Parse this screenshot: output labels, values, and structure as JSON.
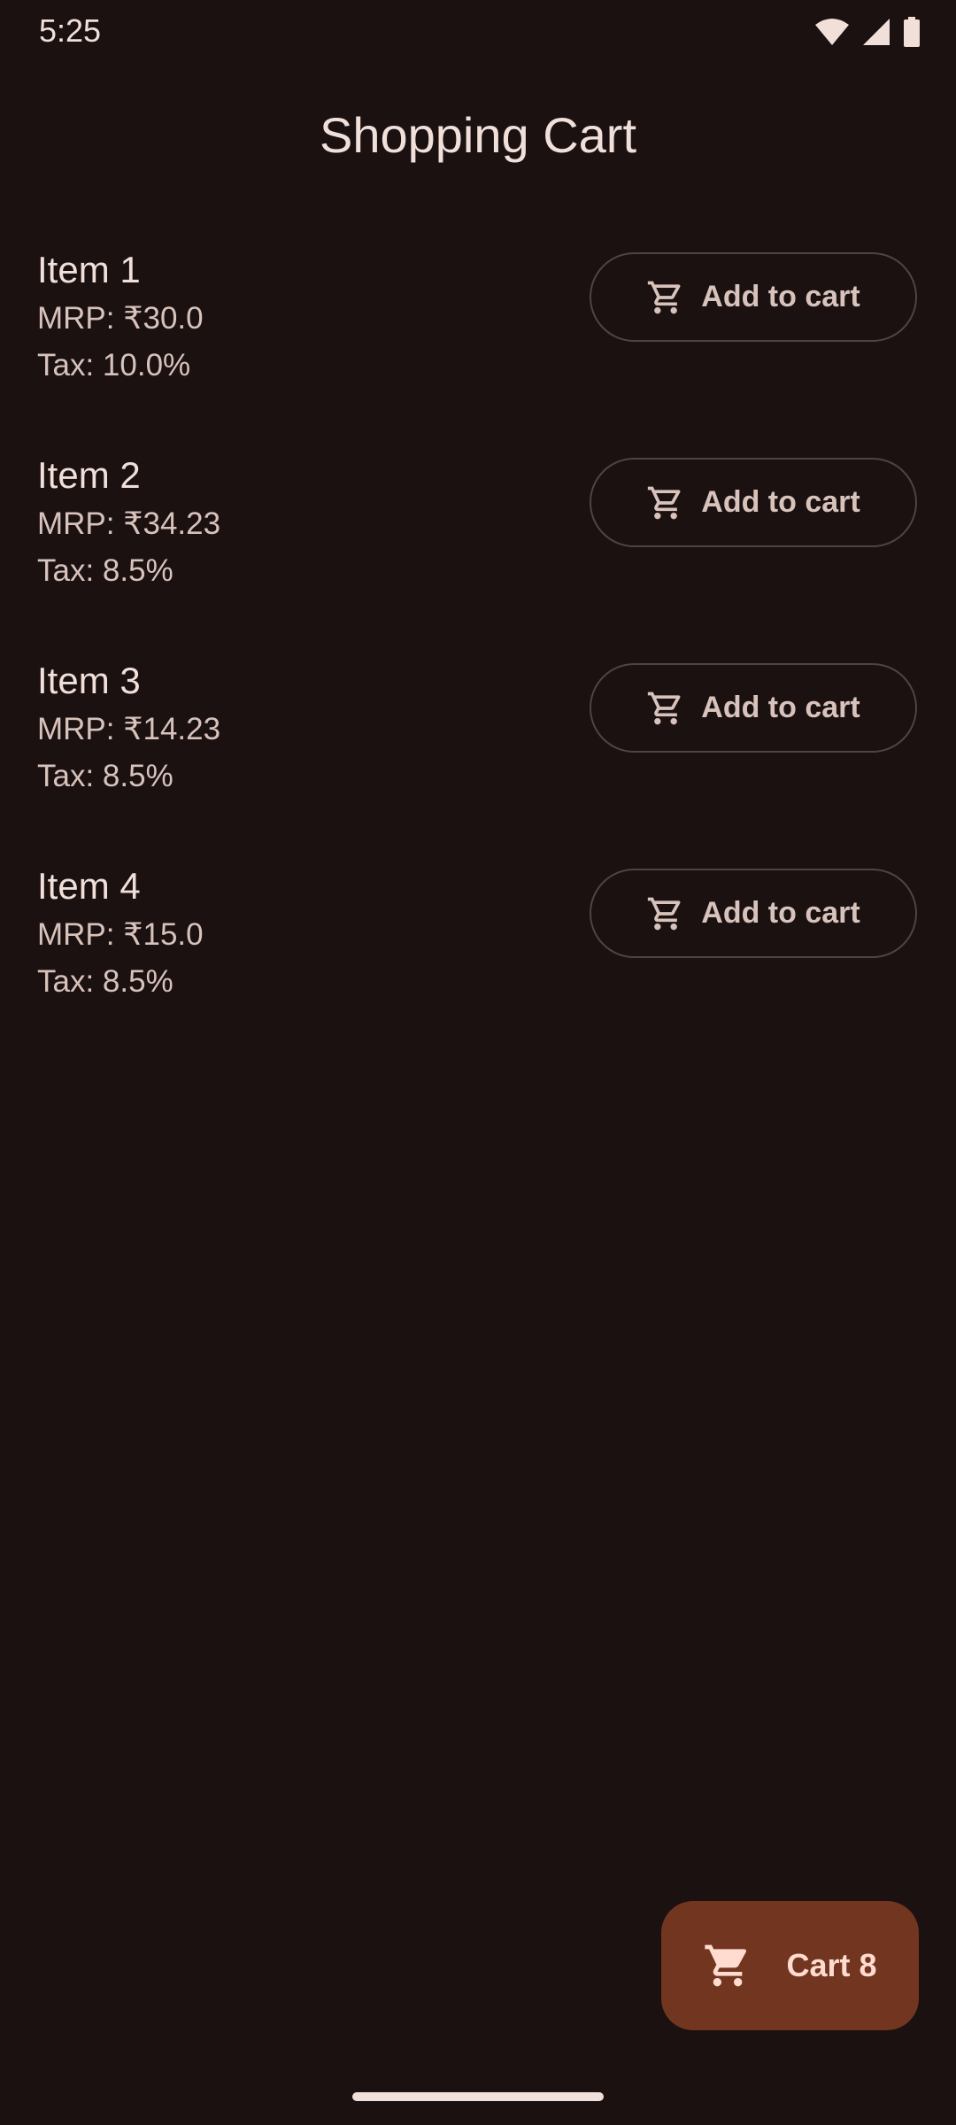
{
  "status_bar": {
    "time": "5:25",
    "icons": [
      "wifi-icon",
      "signal-icon",
      "battery-icon"
    ]
  },
  "header": {
    "title": "Shopping Cart"
  },
  "items": [
    {
      "name": "Item 1",
      "mrp": "MRP: ₹30.0",
      "tax": "Tax: 10.0%",
      "button_label": "Add to cart"
    },
    {
      "name": "Item 2",
      "mrp": "MRP: ₹34.23",
      "tax": "Tax: 8.5%",
      "button_label": "Add to cart"
    },
    {
      "name": "Item 3",
      "mrp": "MRP: ₹14.23",
      "tax": "Tax: 8.5%",
      "button_label": "Add to cart"
    },
    {
      "name": "Item 4",
      "mrp": "MRP: ₹15.0",
      "tax": "Tax: 8.5%",
      "button_label": "Add to cart"
    }
  ],
  "fab": {
    "label": "Cart 8",
    "icon": "cart-icon"
  },
  "colors": {
    "background": "#1a1110",
    "text_primary": "#f1dfda",
    "text_secondary": "#d8c2bc",
    "outline": "#53433f",
    "fab_background": "#723520",
    "fab_text": "#ffdbd0"
  }
}
